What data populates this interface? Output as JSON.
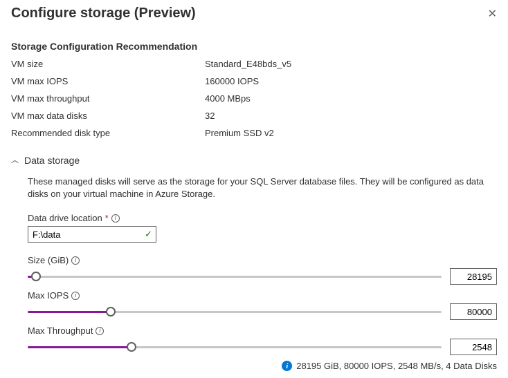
{
  "header": {
    "title": "Configure storage (Preview)"
  },
  "recommendation": {
    "section_title": "Storage Configuration Recommendation",
    "rows": [
      {
        "label": "VM size",
        "value": "Standard_E48bds_v5"
      },
      {
        "label": "VM max IOPS",
        "value": "160000 IOPS"
      },
      {
        "label": "VM max throughput",
        "value": "4000 MBps"
      },
      {
        "label": "VM max data disks",
        "value": "32"
      },
      {
        "label": "Recommended disk type",
        "value": "Premium SSD v2"
      }
    ]
  },
  "data_storage": {
    "title": "Data storage",
    "description": "These managed disks will serve as the storage for your SQL Server database files. They will be configured as data disks on your virtual machine in Azure Storage.",
    "drive_location": {
      "label": "Data drive location",
      "value": "F:\\data"
    },
    "sliders": {
      "size": {
        "label": "Size (GiB)",
        "value": "28195",
        "fill_pct": 2
      },
      "iops": {
        "label": "Max IOPS",
        "value": "80000",
        "fill_pct": 20
      },
      "throughput": {
        "label": "Max Throughput",
        "value": "2548",
        "fill_pct": 25
      }
    },
    "summary": "28195 GiB, 80000 IOPS, 2548 MB/s, 4 Data Disks"
  }
}
